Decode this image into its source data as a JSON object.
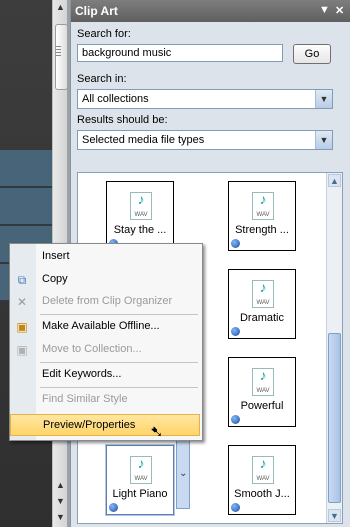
{
  "pane": {
    "title": "Clip Art",
    "search_label": "Search for:",
    "search_value": "background music",
    "go_label": "Go",
    "search_in_label": "Search in:",
    "search_in_value": "All collections",
    "results_label": "Results should be:",
    "results_value": "Selected media file types"
  },
  "clips": [
    {
      "name": "Stay the ..."
    },
    {
      "name": "Strength ..."
    },
    {
      "name": "Dramatic"
    },
    {
      "name": "Powerful"
    },
    {
      "name": "Light Piano"
    },
    {
      "name": "Smooth J..."
    }
  ],
  "clip_type": "WAV",
  "menu": {
    "items": [
      {
        "label": "Insert",
        "disabled": false
      },
      {
        "label": "Copy",
        "disabled": false
      },
      {
        "label": "Delete from Clip Organizer",
        "disabled": true
      },
      {
        "label": "Make Available Offline...",
        "disabled": false
      },
      {
        "label": "Move to Collection...",
        "disabled": true
      },
      {
        "label": "Edit Keywords...",
        "disabled": false
      },
      {
        "label": "Find Similar Style",
        "disabled": true
      },
      {
        "label": "Preview/Properties",
        "disabled": false,
        "highlighted": true
      }
    ]
  },
  "icons": [
    "pin-icon",
    "close-icon",
    "copy-icon",
    "delete-icon",
    "offline-icon",
    "move-icon",
    "dropdown-arrow-icon",
    "globe-icon",
    "wav-icon"
  ]
}
